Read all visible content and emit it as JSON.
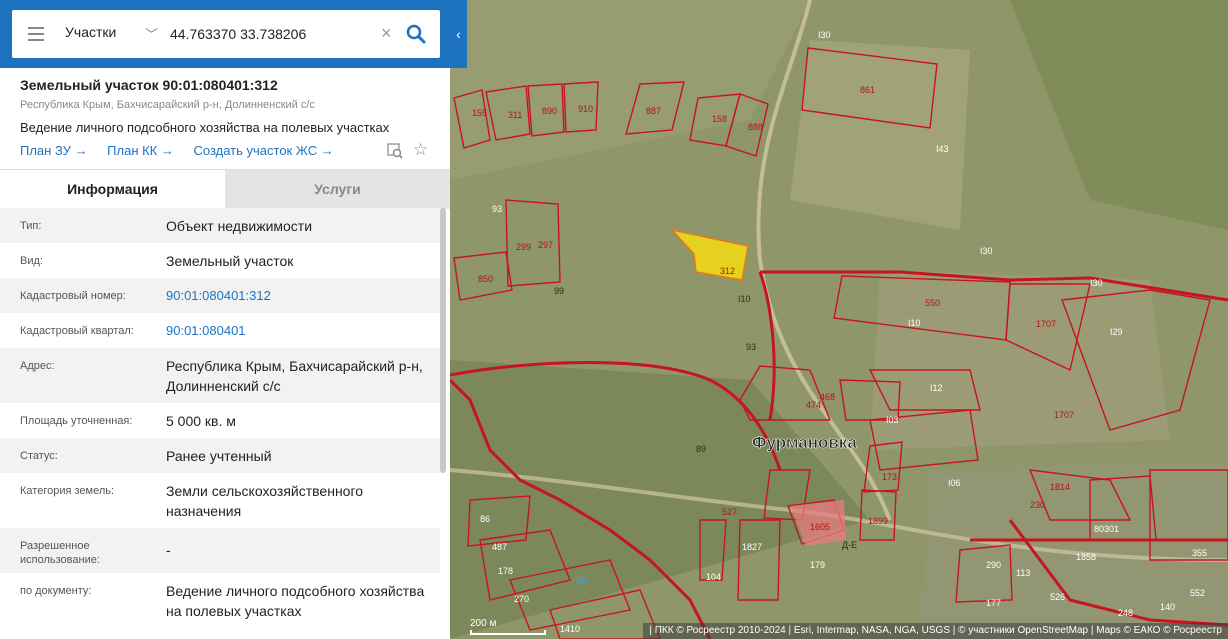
{
  "search": {
    "layer": "Участки",
    "value": "44.763370 33.738206"
  },
  "parcel": {
    "title": "Земельный участок 90:01:080401:312",
    "location": "Республика Крым, Бахчисарайский р-н, Долинненский с/с",
    "purpose": "Ведение личного подсобного хозяйства на полевых участках",
    "links": [
      "План ЗУ →",
      "План КК →",
      "Создать участок ЖС →"
    ]
  },
  "tabs": {
    "info": "Информация",
    "services": "Услуги"
  },
  "rows": [
    {
      "key": "Тип:",
      "value": "Объект недвижимости"
    },
    {
      "key": "Вид:",
      "value": "Земельный участок"
    },
    {
      "key": "Кадастровый номер:",
      "value": "90:01:080401:312"
    },
    {
      "key": "Кадастровый квартал:",
      "value": "90:01:080401"
    },
    {
      "key": "Адрес:",
      "value": "Республика Крым, Бахчисарайский р-н, Долинненский с/с"
    },
    {
      "key": "Площадь уточненная:",
      "value": "5 000 кв. м"
    },
    {
      "key": "Статус:",
      "value": "Ранее учтенный"
    },
    {
      "key": "Категория земель:",
      "value": "Земли сельскохозяйственного назначения"
    },
    {
      "key": "Разрешенное использование:",
      "value": "-"
    },
    {
      "key": "по документу:",
      "value": "Ведение личного подсобного хозяйства на полевых участках"
    }
  ],
  "map": {
    "village": "Фурмановка",
    "scale": "200 м",
    "attribution": "| ПКК © Росреестр 2010-2024 | Esri, Intermap, NASA, NGA, USGS | © участники OpenStreetMap | Maps © ЕАКО © Росреестр",
    "selected_parcel": "312",
    "labels": [
      "861",
      "I30",
      "I43",
      "I30",
      "I30",
      "550",
      "1707",
      "I29",
      "I10",
      "I12",
      "I03",
      "1707",
      "I06",
      "155",
      "311",
      "890",
      "910",
      "887",
      "158",
      "888",
      "93",
      "299",
      "297",
      "850",
      "99",
      "I10",
      "93",
      "468",
      "474",
      "89",
      "173",
      "527",
      "1605",
      "1899",
      "1814",
      "230",
      "80301",
      "86",
      "487",
      "178",
      "270",
      "1410",
      "104",
      "1827",
      "179",
      "1858",
      "290",
      "177",
      "526",
      "248",
      "355",
      "Д-Е",
      "5б",
      "552",
      "113",
      "140"
    ]
  },
  "colors": {
    "brand": "#1e73c1",
    "parcel_border": "#c8141e",
    "selected_fill": "#e6d21e"
  }
}
